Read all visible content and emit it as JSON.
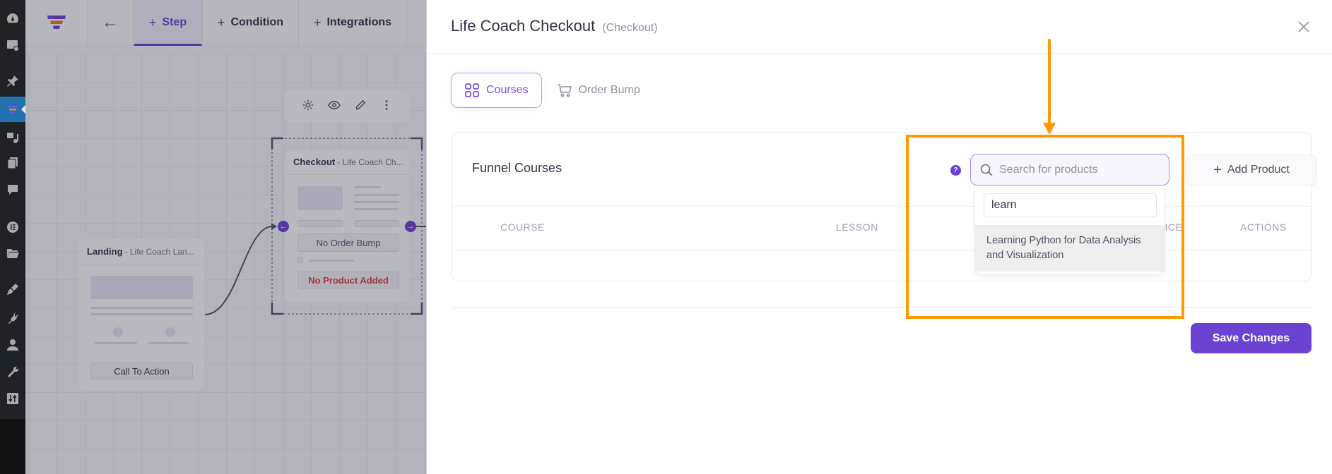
{
  "wp_sidebar": {
    "items": [
      {
        "icon": "dashboard-icon"
      },
      {
        "icon": "site-check-icon"
      },
      {
        "icon": "pin-icon"
      },
      {
        "icon": "funnel-icon",
        "active": true
      },
      {
        "icon": "media-icon"
      },
      {
        "icon": "pages-icon"
      },
      {
        "icon": "comments-icon"
      },
      {
        "icon": "elementor-icon"
      },
      {
        "icon": "folder-icon"
      },
      {
        "icon": "appearance-icon"
      },
      {
        "icon": "plugins-icon"
      },
      {
        "icon": "users-icon"
      },
      {
        "icon": "tools-icon"
      },
      {
        "icon": "settings-icon"
      },
      {
        "icon": "play-icon"
      }
    ]
  },
  "builder": {
    "topbar": {
      "back_label": "←",
      "tabs": [
        {
          "label": "Step",
          "active": true
        },
        {
          "label": "Condition"
        },
        {
          "label": "Integrations"
        }
      ]
    },
    "nodes": {
      "landing": {
        "type": "Landing",
        "name": "- Life Coach Lan...",
        "cta_label": "Call To Action"
      },
      "checkout": {
        "type": "Checkout",
        "name": "- Life Coach Ch...",
        "order_bump_label": "No Order Bump",
        "no_product_label": "No Product Added"
      }
    }
  },
  "panel": {
    "title": "Life Coach Checkout",
    "subtitle": "(Checkout)",
    "tabs": [
      {
        "label": "Courses",
        "icon": "grid-icon",
        "active": true
      },
      {
        "label": "Order Bump",
        "icon": "cart-icon"
      }
    ],
    "card": {
      "title": "Funnel Courses",
      "help_label": "?",
      "search": {
        "placeholder": "Search for products",
        "value": ""
      },
      "add_product_label": "Add Product",
      "dropdown": {
        "query": "learn",
        "options": [
          "Learning Python for Data Analysis and Visualization"
        ]
      },
      "columns": [
        "COURSE",
        "LESSON",
        "PRICE",
        "ACTIONS"
      ],
      "rows": []
    },
    "save_label": "Save Changes"
  },
  "annotation": {
    "color": "#ff9900"
  }
}
